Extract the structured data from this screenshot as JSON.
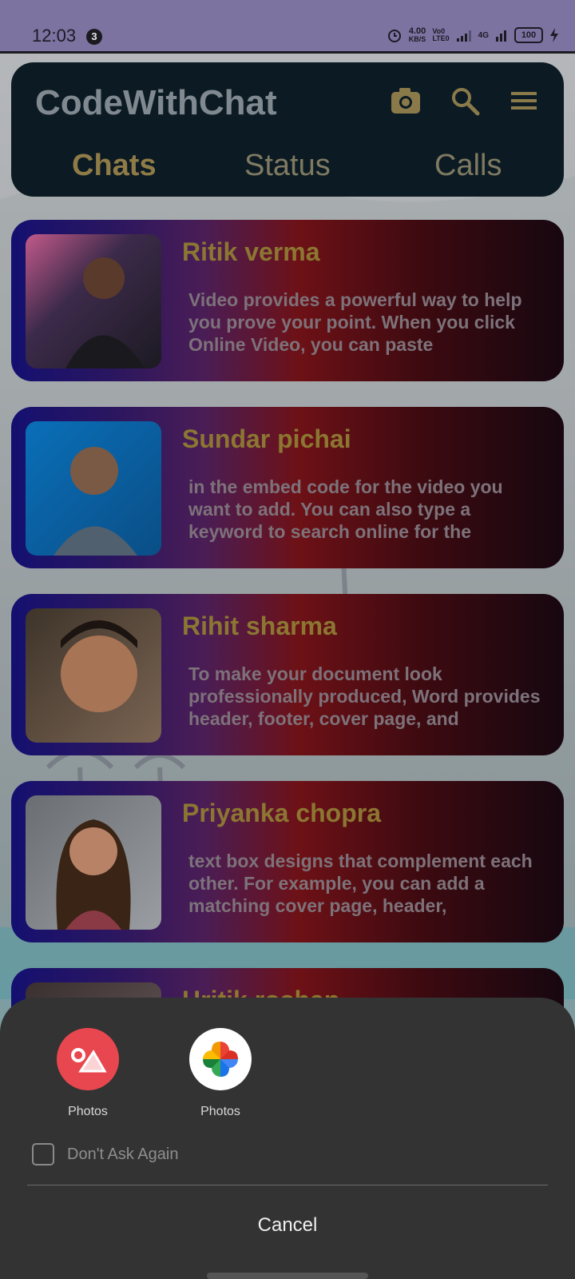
{
  "status_bar": {
    "time": "12:03",
    "notification_count": "3",
    "net_speed_value": "4.00",
    "net_speed_unit": "KB/S",
    "volte_line1": "Vo0",
    "volte_line2": "LTE0",
    "network_type": "4G",
    "battery": "100"
  },
  "app": {
    "title": "CodeWithChat",
    "tabs": [
      {
        "label": "Chats",
        "active": true
      },
      {
        "label": "Status",
        "active": false
      },
      {
        "label": "Calls",
        "active": false
      }
    ],
    "icons": [
      "camera-icon",
      "search-icon",
      "menu-icon"
    ]
  },
  "chats": [
    {
      "name": "Ritik verma",
      "message": "Video provides a powerful way to help you prove your point. When you click Online Video, you can paste"
    },
    {
      "name": "Sundar pichai",
      "message": "in the embed code for the video you want to add. You can also type a keyword to search online for the"
    },
    {
      "name": "Rihit sharma",
      "message": "To make your document look professionally produced, Word provides header, footer, cover page, and"
    },
    {
      "name": "Priyanka chopra",
      "message": "text box designs that complement each other. For example, you can add a matching cover page, header,"
    },
    {
      "name": "Hritik roshan",
      "message": ""
    }
  ],
  "chooser": {
    "apps": [
      {
        "label": "Photos",
        "icon": "gallery-photos-icon"
      },
      {
        "label": "Photos",
        "icon": "google-photos-icon"
      }
    ],
    "dont_ask_label": "Don't Ask Again",
    "dont_ask_checked": false,
    "cancel_label": "Cancel"
  },
  "colors": {
    "status_bar": "#7c73a1",
    "app_bar": "#0c1b23",
    "tab_active": "#8f7b47",
    "chat_name": "#8c7732",
    "sheet": "#333333"
  }
}
